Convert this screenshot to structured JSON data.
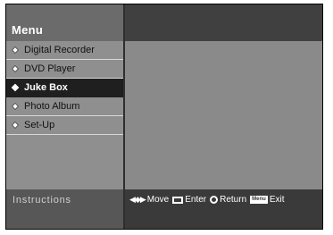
{
  "header": {
    "title": "Menu"
  },
  "sidebar": {
    "items": [
      {
        "label": "Digital Recorder",
        "active": false
      },
      {
        "label": "DVD Player",
        "active": false
      },
      {
        "label": "Juke Box",
        "active": true
      },
      {
        "label": "Photo Album",
        "active": false
      },
      {
        "label": "Set-Up",
        "active": false
      }
    ]
  },
  "instructions": {
    "label": "Instructions",
    "move_label": "Move",
    "enter_label": "Enter",
    "return_label": "Return",
    "menu_key_label": "Menu",
    "exit_label": "Exit"
  },
  "icons": [
    "diamond-bullet-icon",
    "arrows-icon",
    "enter-icon",
    "return-icon",
    "menu-key-icon"
  ],
  "colors": {
    "active_item_bg": "#1f1f1f",
    "panel_bg": "#8c8c8c",
    "header_bg": "#404040"
  }
}
